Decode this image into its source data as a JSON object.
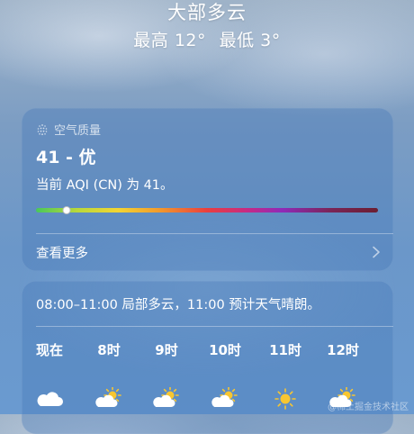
{
  "header": {
    "condition": "大部多云",
    "high": "最高 12°",
    "low": "最低 3°"
  },
  "aqi": {
    "title": "空气质量",
    "icon": "air-quality-dots-icon",
    "value_text": "41 - 优",
    "description": "当前 AQI (CN) 为 41。",
    "scale_position": 0.09,
    "see_more": "查看更多"
  },
  "forecast": {
    "summary": "08:00–11:00 局部多云，11:00 预计天气晴朗。",
    "hours": [
      {
        "label": "现在",
        "icon": "cloud-icon"
      },
      {
        "label": "8时",
        "icon": "partly-sunny-icon"
      },
      {
        "label": "9时",
        "icon": "partly-sunny-icon"
      },
      {
        "label": "10时",
        "icon": "partly-sunny-icon"
      },
      {
        "label": "11时",
        "icon": "sun-icon"
      },
      {
        "label": "12时",
        "icon": "partly-sunny-icon"
      }
    ]
  },
  "watermark": "@稀土掘金技术社区",
  "colors": {
    "sun": "#f8c630",
    "cloud": "#ffffff"
  }
}
